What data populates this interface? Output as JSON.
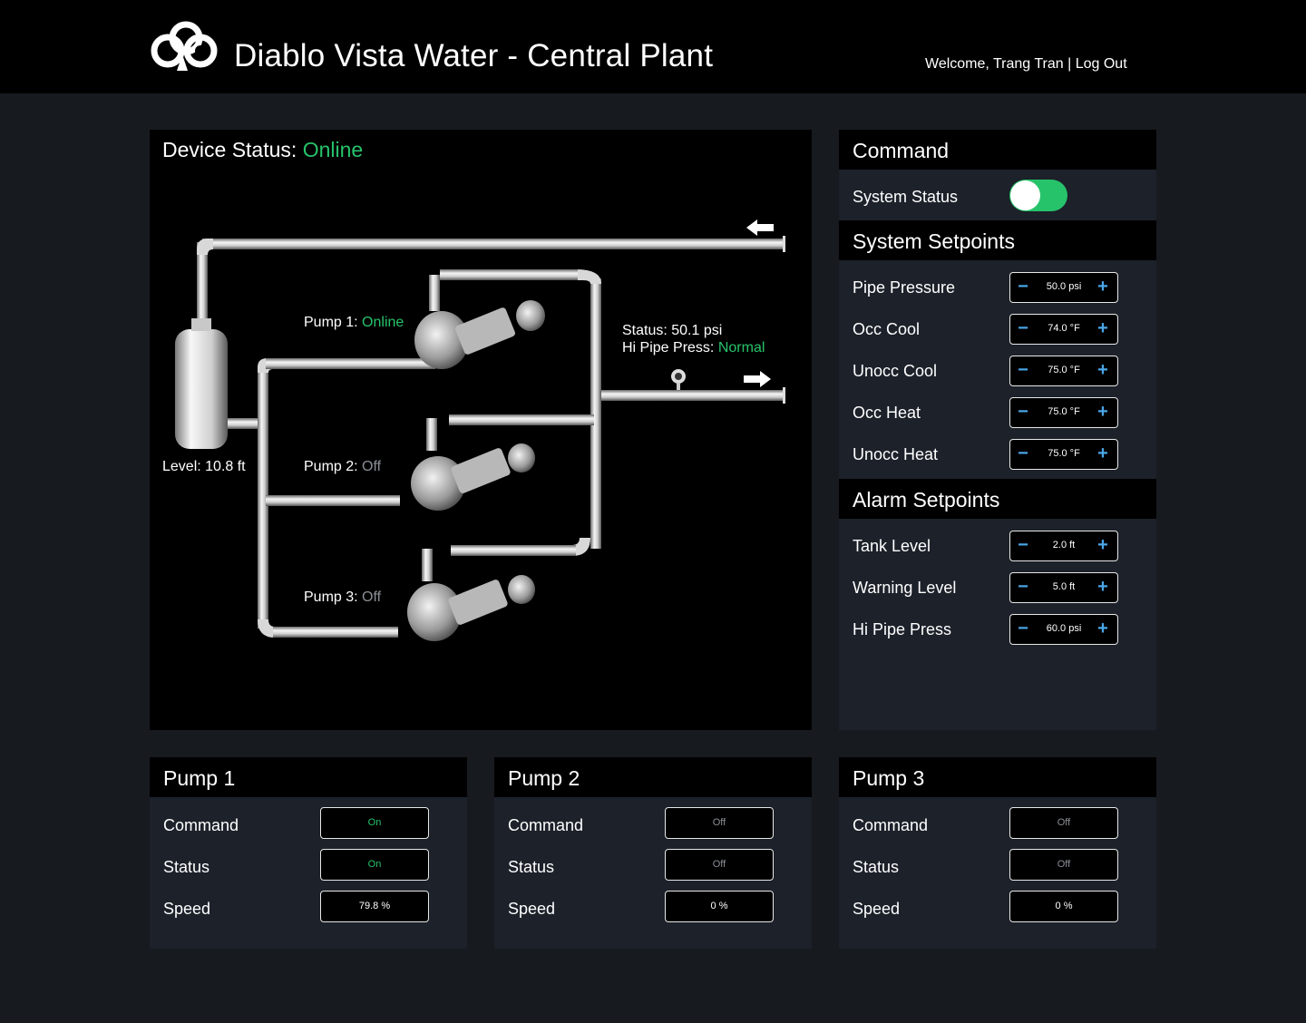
{
  "header": {
    "title": "Diablo Vista Water - Central Plant",
    "welcome": "Welcome, Trang Tran",
    "separator": "|",
    "logout": "Log Out"
  },
  "diagram": {
    "device_status_label": "Device Status:",
    "device_status_value": "Online",
    "pump1_label": "Pump 1:",
    "pump1_state": "Online",
    "pump2_label": "Pump 2:",
    "pump2_state": "Off",
    "pump3_label": "Pump 3:",
    "pump3_state": "Off",
    "pressure_status": "Status: 50.1 psi",
    "hi_pipe_label": "Hi Pipe Press:",
    "hi_pipe_value": "Normal",
    "level": "Level: 10.8 ft"
  },
  "command": {
    "title": "Command",
    "system_status_label": "System Status",
    "system_status_on": true
  },
  "system_setpoints": {
    "title": "System Setpoints",
    "items": [
      {
        "label": "Pipe Pressure",
        "value": "50.0 psi"
      },
      {
        "label": "Occ Cool",
        "value": "74.0 °F"
      },
      {
        "label": "Unocc Cool",
        "value": "75.0 °F"
      },
      {
        "label": "Occ Heat",
        "value": "75.0 °F"
      },
      {
        "label": "Unocc Heat",
        "value": "75.0 °F"
      }
    ]
  },
  "alarm_setpoints": {
    "title": "Alarm Setpoints",
    "items": [
      {
        "label": "Tank Level",
        "value": "2.0 ft"
      },
      {
        "label": "Warning Level",
        "value": "5.0 ft"
      },
      {
        "label": "Hi Pipe Press",
        "value": "60.0 psi"
      }
    ]
  },
  "stepper_glyphs": {
    "minus": "−",
    "plus": "+"
  },
  "pumps": [
    {
      "title": "Pump 1",
      "command_label": "Command",
      "command": "On",
      "status_label": "Status",
      "status": "On",
      "speed_label": "Speed",
      "speed": "79.8 %"
    },
    {
      "title": "Pump 2",
      "command_label": "Command",
      "command": "Off",
      "status_label": "Status",
      "status": "Off",
      "speed_label": "Speed",
      "speed": "0 %"
    },
    {
      "title": "Pump 3",
      "command_label": "Command",
      "command": "Off",
      "status_label": "Status",
      "status": "Off",
      "speed_label": "Speed",
      "speed": "0 %"
    }
  ],
  "colors": {
    "online": "#27c36b",
    "off": "#8b8f96",
    "accent": "#4aa6e8"
  }
}
